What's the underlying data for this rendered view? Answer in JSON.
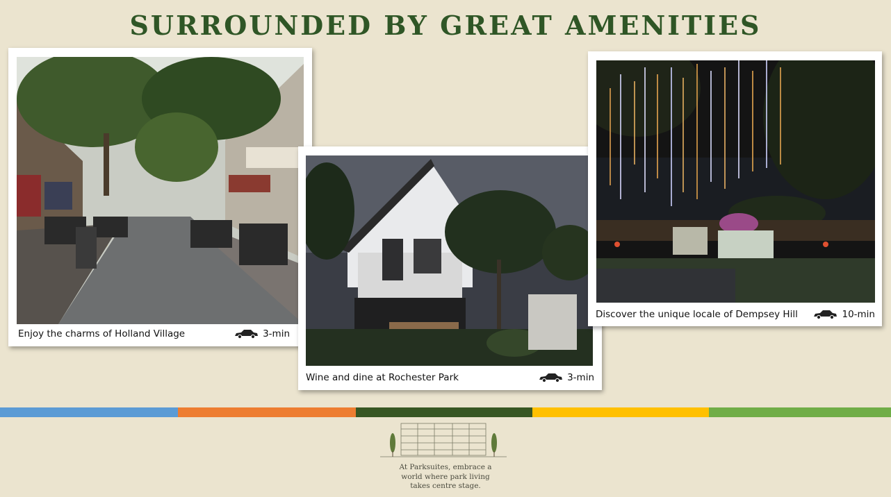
{
  "title": "SURROUNDED BY GREAT AMENITIES",
  "cards": [
    {
      "caption": "Enjoy the charms of Holland Village",
      "icon": "car-icon",
      "time": "3-min",
      "photo": "holland-village-street-photo"
    },
    {
      "caption": "Wine and dine at Rochester Park",
      "icon": "car-icon",
      "time": "3-min",
      "photo": "rochester-park-house-photo"
    },
    {
      "caption": "Discover the unique locale of Dempsey Hill",
      "icon": "car-icon",
      "time": "10-min",
      "photo": "dempsey-hill-night-photo"
    }
  ],
  "color_strip": [
    "#5b9bd5",
    "#ed7d31",
    "#375623",
    "#ffc000",
    "#70ad47"
  ],
  "footer": {
    "logo": "parksuites-building-logo",
    "tagline_lines": [
      "At Parksuites, embrace a",
      "world where park living",
      "takes centre stage."
    ]
  }
}
